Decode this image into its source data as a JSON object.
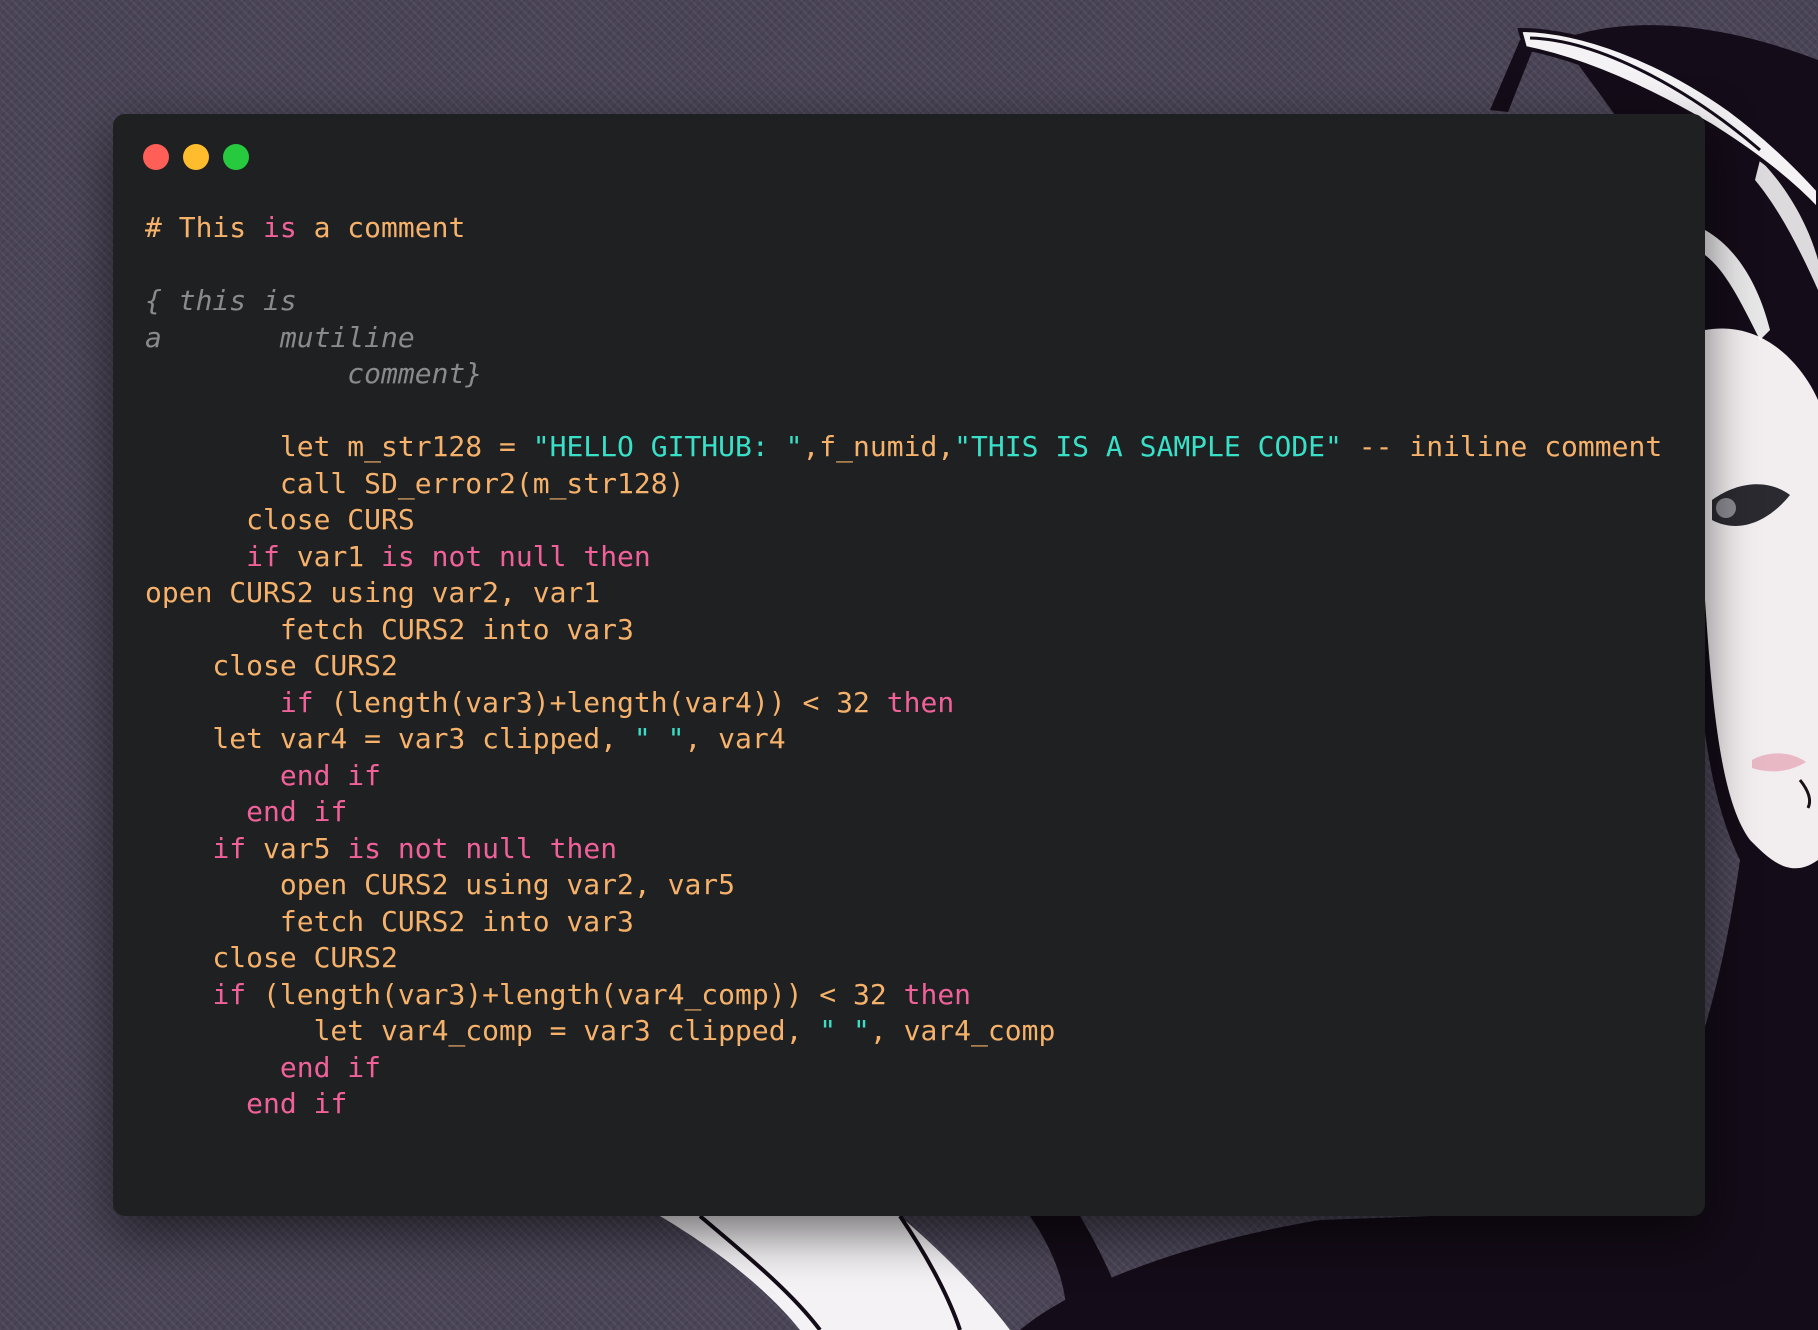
{
  "colors": {
    "background": "#4a4456",
    "window": "#1f2022",
    "text_default": "#f6b26b",
    "keyword": "#f0619a",
    "string": "#38e0c8",
    "number": "#f6b26b",
    "comment_block": "#8a8a8a",
    "close_button": "#ff5f56",
    "minimize_button": "#ffbd2e",
    "maximize_button": "#27c93f"
  },
  "window_controls": [
    {
      "name": "close-button",
      "icon": "red-dot-icon"
    },
    {
      "name": "minimize-button",
      "icon": "yellow-dot-icon"
    },
    {
      "name": "maximize-button",
      "icon": "green-dot-icon"
    }
  ],
  "code_lines": [
    [
      {
        "t": "# This ",
        "c": "d"
      },
      {
        "t": "is",
        "c": "k"
      },
      {
        "t": " a comment",
        "c": "d"
      }
    ],
    [],
    [
      {
        "t": "{ this is",
        "c": "m"
      }
    ],
    [
      {
        "t": "a       mutiline",
        "c": "m"
      }
    ],
    [
      {
        "t": "            comment}",
        "c": "m"
      }
    ],
    [],
    [
      {
        "t": "        let m_str128 = ",
        "c": "d"
      },
      {
        "t": "\"HELLO GITHUB: \"",
        "c": "s"
      },
      {
        "t": ",f_numid,",
        "c": "d"
      },
      {
        "t": "\"THIS IS A SAMPLE CODE\"",
        "c": "s"
      },
      {
        "t": " -- iniline comment",
        "c": "d"
      }
    ],
    [
      {
        "t": "        call SD_error2(m_str128)",
        "c": "d"
      }
    ],
    [
      {
        "t": "      close CURS",
        "c": "d"
      }
    ],
    [
      {
        "t": "      ",
        "c": "d"
      },
      {
        "t": "if",
        "c": "k"
      },
      {
        "t": " var1 ",
        "c": "d"
      },
      {
        "t": "is",
        "c": "k"
      },
      {
        "t": " ",
        "c": "d"
      },
      {
        "t": "not",
        "c": "k"
      },
      {
        "t": " ",
        "c": "d"
      },
      {
        "t": "null",
        "c": "k"
      },
      {
        "t": " ",
        "c": "d"
      },
      {
        "t": "then",
        "c": "k"
      }
    ],
    [
      {
        "t": "open CURS2 using var2, var1",
        "c": "d"
      }
    ],
    [
      {
        "t": "        fetch CURS2 into var3",
        "c": "d"
      }
    ],
    [
      {
        "t": "    close CURS2",
        "c": "d"
      }
    ],
    [
      {
        "t": "        ",
        "c": "d"
      },
      {
        "t": "if",
        "c": "k"
      },
      {
        "t": " (length(var3)+length(var4)) < ",
        "c": "d"
      },
      {
        "t": "32",
        "c": "n"
      },
      {
        "t": " ",
        "c": "d"
      },
      {
        "t": "then",
        "c": "k"
      }
    ],
    [
      {
        "t": "    let var4 = var3 clipped, ",
        "c": "d"
      },
      {
        "t": "\" \"",
        "c": "s"
      },
      {
        "t": ", var4",
        "c": "d"
      }
    ],
    [
      {
        "t": "        ",
        "c": "d"
      },
      {
        "t": "end",
        "c": "k"
      },
      {
        "t": " ",
        "c": "d"
      },
      {
        "t": "if",
        "c": "k"
      }
    ],
    [
      {
        "t": "      ",
        "c": "d"
      },
      {
        "t": "end",
        "c": "k"
      },
      {
        "t": " ",
        "c": "d"
      },
      {
        "t": "if",
        "c": "k"
      }
    ],
    [
      {
        "t": "    ",
        "c": "d"
      },
      {
        "t": "if",
        "c": "k"
      },
      {
        "t": " var5 ",
        "c": "d"
      },
      {
        "t": "is",
        "c": "k"
      },
      {
        "t": " ",
        "c": "d"
      },
      {
        "t": "not",
        "c": "k"
      },
      {
        "t": " ",
        "c": "d"
      },
      {
        "t": "null",
        "c": "k"
      },
      {
        "t": " ",
        "c": "d"
      },
      {
        "t": "then",
        "c": "k"
      }
    ],
    [
      {
        "t": "        open CURS2 using var2, var5",
        "c": "d"
      }
    ],
    [
      {
        "t": "        fetch CURS2 into var3",
        "c": "d"
      }
    ],
    [
      {
        "t": "    close CURS2",
        "c": "d"
      }
    ],
    [
      {
        "t": "    ",
        "c": "d"
      },
      {
        "t": "if",
        "c": "k"
      },
      {
        "t": " (length(var3)+length(var4_comp)) < ",
        "c": "d"
      },
      {
        "t": "32",
        "c": "n"
      },
      {
        "t": " ",
        "c": "d"
      },
      {
        "t": "then",
        "c": "k"
      }
    ],
    [
      {
        "t": "          let var4_comp = var3 clipped, ",
        "c": "d"
      },
      {
        "t": "\" \"",
        "c": "s"
      },
      {
        "t": ", var4_comp",
        "c": "d"
      }
    ],
    [
      {
        "t": "        ",
        "c": "d"
      },
      {
        "t": "end",
        "c": "k"
      },
      {
        "t": " ",
        "c": "d"
      },
      {
        "t": "if",
        "c": "k"
      }
    ],
    [
      {
        "t": "      ",
        "c": "d"
      },
      {
        "t": "end",
        "c": "k"
      },
      {
        "t": " ",
        "c": "d"
      },
      {
        "t": "if",
        "c": "k"
      }
    ]
  ]
}
